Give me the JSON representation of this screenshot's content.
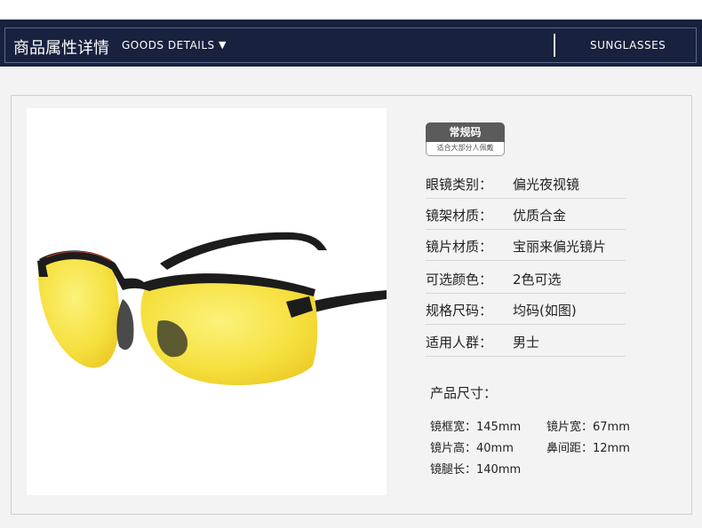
{
  "header": {
    "title_cn": "商品属性详情",
    "title_en": "GOODS DETAILS",
    "arrow": "▼",
    "right_label": "SUNGLASSES"
  },
  "product_image": {
    "subject": "semi-rimless sunglasses with yellow night-vision lenses and black metal frame",
    "lens_color": "#f7e24a",
    "frame_color": "#1c1c1c"
  },
  "badge": {
    "title": "常规码",
    "subtitle": "适合大部分人佩戴"
  },
  "attributes": [
    {
      "label": "眼镜类别：",
      "value": "偏光夜视镜"
    },
    {
      "label": "镜架材质：",
      "value": "优质合金"
    },
    {
      "label": "镜片材质：",
      "value": "宝丽来偏光镜片"
    },
    {
      "label": "可选颜色：",
      "value": "2色可选"
    },
    {
      "label": "规格尺码：",
      "value": "均码(如图)"
    },
    {
      "label": "适用人群：",
      "value": "男士"
    }
  ],
  "sizes": {
    "title": "产品尺寸：",
    "items": [
      "镜框宽：145mm",
      "镜片宽：67mm",
      "镜片高：40mm",
      "鼻间距：12mm",
      "镜腿长：140mm"
    ]
  },
  "colors": {
    "header_bg": "#18213d",
    "page_bg": "#f3f3f3",
    "badge_bg": "#5b5b5b"
  }
}
